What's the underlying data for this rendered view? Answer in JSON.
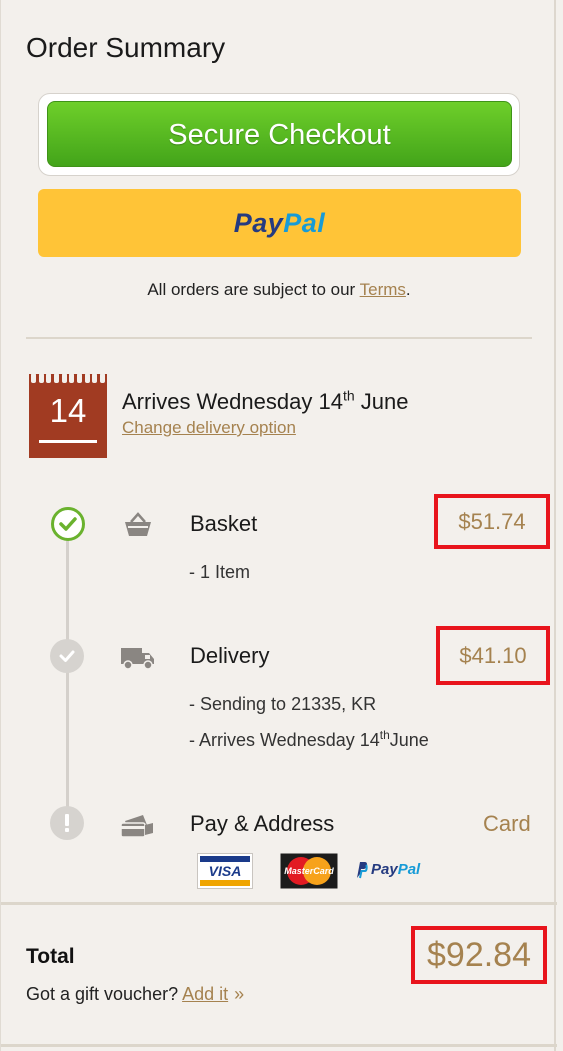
{
  "summary": {
    "title": "Order Summary",
    "checkout_label": "Secure Checkout",
    "paypal_part1": "Pay",
    "paypal_part2": "Pal",
    "terms_prefix": "All orders are subject to our ",
    "terms_link": "Terms",
    "terms_suffix": "."
  },
  "delivery_date": {
    "day": "14",
    "arrives_prefix": "Arrives Wednesday 14",
    "arrives_sup": "th",
    "arrives_suffix": " June",
    "change_link": "Change delivery option"
  },
  "steps": {
    "basket": {
      "label": "Basket",
      "price": "$51.74",
      "detail": "- 1 Item"
    },
    "delivery": {
      "label": "Delivery",
      "price": "$41.10",
      "detail1": "- Sending to 21335, KR",
      "detail2_prefix": "- Arrives Wednesday 14",
      "detail2_sup": "th",
      "detail2_suffix": "June"
    },
    "pay": {
      "label": "Pay & Address",
      "method": "Card"
    }
  },
  "cards": {
    "visa": "VISA",
    "mastercard": "MasterCard",
    "paypal_part1": "Pay",
    "paypal_part2": "Pal"
  },
  "total": {
    "label": "Total",
    "amount": "$92.84",
    "voucher_prefix": "Got a gift voucher? ",
    "voucher_link": "Add it",
    "voucher_chevron": "»"
  },
  "colors": {
    "background": "#f3f0ec",
    "accent_gold": "#a5824f",
    "checkout_green": "#5cbc22",
    "paypal_yellow": "#ffc437",
    "calendar_red": "#a13b22",
    "highlight_red": "#e8141c"
  }
}
